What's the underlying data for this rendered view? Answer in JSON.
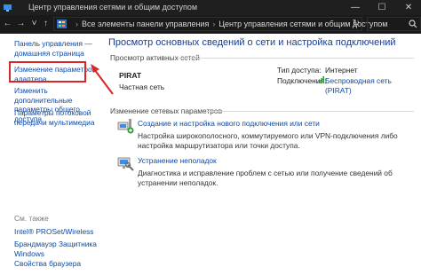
{
  "window": {
    "title": "Центр управления сетями и общим доступом",
    "minimize": "—",
    "maximize": "☐",
    "close": "✕"
  },
  "address": {
    "back": "←",
    "forward": "→",
    "dropdown": "˅",
    "up": "↑",
    "crumb1": "Все элементы панели управления",
    "crumb_sep": "›",
    "crumb2": "Центр управления сетями и общим доступом",
    "refresh": "↻",
    "search_icon": "search-icon"
  },
  "sidebar": {
    "home": "Панель управления — домашняя страница",
    "adapter": "Изменение параметров адаптера",
    "sharing": "Изменить дополнительные параметры общего доступа",
    "streaming": "Параметры потоковой передачи мультимедиа",
    "see_also_title": "См. также",
    "intel": "Intel® PROSet/Wireless",
    "firewall": "Брандмауэр Защитника Windows",
    "browser": "Свойства браузера"
  },
  "main": {
    "heading": "Просмотр основных сведений о сети и настройка подключений",
    "active_title": "Просмотр активных сетей",
    "network_name": "PIRAT",
    "network_type": "Частная сеть",
    "access_label": "Тип доступа:",
    "access_value": "Интернет",
    "conn_label": "Подключения:",
    "conn_value": "Беспроводная сеть (PIRAT)",
    "change_title": "Изменение сетевых параметров",
    "action1_link": "Создание и настройка нового подключения или сети",
    "action1_desc": "Настройка широкополосного, коммутируемого или VPN-подключения либо настройка маршрутизатора или точки доступа.",
    "action2_link": "Устранение неполадок",
    "action2_desc": "Диагностика и исправление проблем с сетью или получение сведений об устранении неполадок."
  },
  "colors": {
    "link": "#0b4aa8",
    "heading": "#183c8c",
    "highlight_red": "#d6282b",
    "titlebar": "#1f1f1f"
  }
}
